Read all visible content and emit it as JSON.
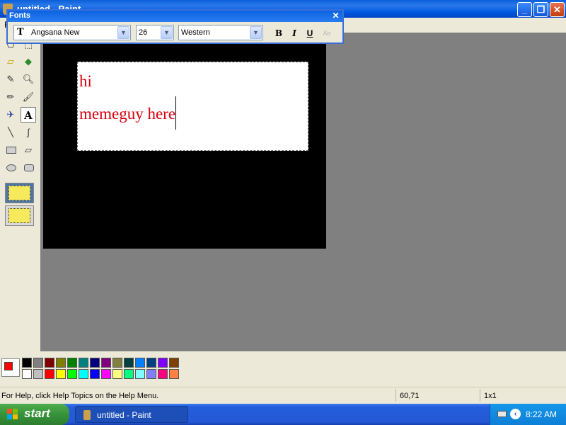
{
  "window": {
    "title": "untitled - Paint",
    "minimize_icon": "minimize-icon",
    "maximize_icon": "restore-icon",
    "close_icon": "close-icon"
  },
  "menubar": {
    "visible_item": "F"
  },
  "fonts_toolbar": {
    "title": "Fonts",
    "font_name": "Angsana New",
    "font_size": "26",
    "script": "Western",
    "bold_label": "B",
    "italic_label": "I",
    "underline_label": "U",
    "vertical_label": "Ab"
  },
  "canvas": {
    "text_lines": [
      "hi",
      "memeguy here"
    ],
    "text_color": "#d7000f"
  },
  "palette": {
    "foreground": "#ff0000",
    "background": "#ffffff",
    "row1": [
      "#000000",
      "#808080",
      "#800000",
      "#808000",
      "#008000",
      "#008080",
      "#000080",
      "#800080",
      "#808040",
      "#004040",
      "#0080ff",
      "#004080",
      "#8000ff",
      "#804000"
    ],
    "row2": [
      "#ffffff",
      "#c0c0c0",
      "#ff0000",
      "#ffff00",
      "#00ff00",
      "#00ffff",
      "#0000ff",
      "#ff00ff",
      "#ffff80",
      "#00ff80",
      "#80ffff",
      "#8080ff",
      "#ff0080",
      "#ff8040"
    ]
  },
  "statusbar": {
    "help": "For Help, click Help Topics on the Help Menu.",
    "coords": "60,71",
    "size": "1x1"
  },
  "taskbar": {
    "start_label": "start",
    "task_label": "untitled - Paint",
    "clock": "8:22 AM"
  }
}
